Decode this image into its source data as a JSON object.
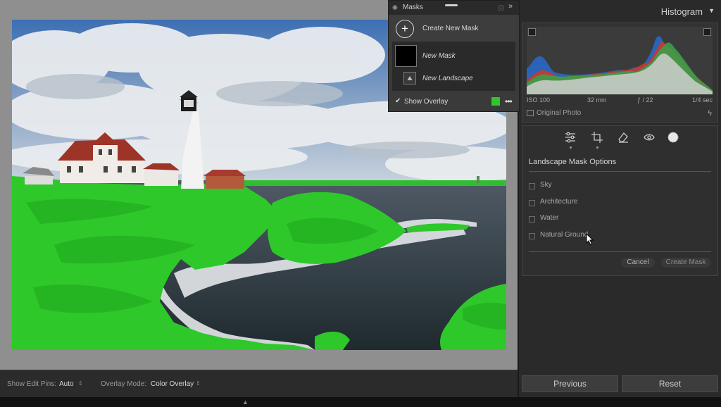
{
  "canvas": {
    "overlay_color": "#2ec82a"
  },
  "toolbar": {
    "edit_pins_label": "Show Edit Pins:",
    "edit_pins_value": "Auto",
    "overlay_mode_label": "Overlay Mode:",
    "overlay_mode_value": "Color Overlay"
  },
  "masks_panel": {
    "title": "Masks",
    "create_new": "Create New Mask",
    "mask_name": "New Mask",
    "component_name": "New Landscape",
    "show_overlay_label": "Show Overlay",
    "show_overlay_checked": true,
    "overlay_swatch": "#2ec82a"
  },
  "histogram": {
    "title": "Histogram",
    "iso": "ISO 100",
    "focal": "32 mm",
    "aperture": "ƒ / 22",
    "shutter": "1/4 sec",
    "original_photo": "Original Photo"
  },
  "landscape_options": {
    "title": "Landscape Mask Options",
    "options": [
      {
        "label": "Sky",
        "checked": false
      },
      {
        "label": "Architecture",
        "checked": false
      },
      {
        "label": "Water",
        "checked": false
      },
      {
        "label": "Natural Ground",
        "checked": false
      }
    ],
    "cancel": "Cancel",
    "create": "Create Mask"
  },
  "nav": {
    "previous": "Previous",
    "reset": "Reset"
  }
}
